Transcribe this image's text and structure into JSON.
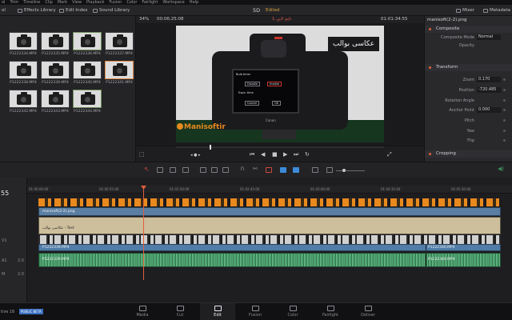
{
  "menubar": [
    "ol",
    "Trim",
    "Timeline",
    "Clip",
    "Mark",
    "View",
    "Playback",
    "Fusion",
    "Color",
    "Fairlight",
    "Workspace",
    "Help"
  ],
  "toolbar": {
    "left_label": "ol",
    "effects_library": "Effects Library",
    "edit_index": "Edit Index",
    "sound_library": "Sound Library",
    "project": "5D",
    "status": "Edited",
    "mixer": "Mixer",
    "metadata": "Metadata"
  },
  "media_pool": {
    "items": [
      {
        "name": "P1222334.MP4",
        "state": "normal"
      },
      {
        "name": "P1222335.MP4",
        "state": "normal"
      },
      {
        "name": "P1222336.MP4",
        "state": "highlight"
      },
      {
        "name": "P1222337.MP4",
        "state": "normal"
      },
      {
        "name": "P1222338.MP4",
        "state": "normal"
      },
      {
        "name": "P1222339.MP4",
        "state": "normal"
      },
      {
        "name": "P1222340.MP4",
        "state": "normal"
      },
      {
        "name": "P1222341.MP4",
        "state": "selected"
      },
      {
        "name": "P1222342.MP4",
        "state": "normal"
      },
      {
        "name": "P1222343.MP4",
        "state": "normal"
      },
      {
        "name": "P1222344.MP4",
        "state": "highlight"
      }
    ]
  },
  "viewer": {
    "zoom": "34%",
    "source_tc": "00:06:25:08",
    "clip_title": "تایم لاین 1",
    "record_tc": "01:01:34:55",
    "overlay_text": "عکاسی بوالب",
    "logo_text": "Manisoftir",
    "lcd": {
      "title": "Bulb timer",
      "disable": "Disable",
      "enable": "Enable",
      "expo": "Expo. time",
      "cancel": "Cancel",
      "ok": "OK"
    },
    "brand": "Canon"
  },
  "inspector": {
    "title": "manisoft(2-2).png",
    "composite": "Composite",
    "composite_mode_label": "Composite Mode",
    "composite_mode_value": "Normal",
    "opacity_label": "Opacity",
    "transform": "Transform",
    "zoom_label": "Zoom",
    "zoom_value": "0.170",
    "position_label": "Position",
    "position_value": "-720.485",
    "rotation_label": "Rotation Angle",
    "rotation_value": "0.000",
    "anchor_label": "Anchor Point",
    "anchor_value": "0.000",
    "pitch_label": "Pitch",
    "yaw_label": "Yaw",
    "flip_label": "Flip",
    "cropping": "Cropping"
  },
  "timeline": {
    "timecode": "55",
    "ruler": [
      "01:00:00:00",
      "01:00:55:00",
      "01:01:50:00",
      "01:02:45:00",
      "01:03:40:00",
      "01:04:35:00",
      "01:05:30:00"
    ],
    "tracks": {
      "v3_clip": "manisoft(2-2).png",
      "v2_clip": "عکاسی بوالب - Text",
      "v1_clip_a": "P1222339.MP4",
      "v1_clip_b": "P1222340.MP4",
      "a1_clip_a": "P1222339.MP4",
      "a1_clip_b": "P1222340.MP4"
    },
    "track_labels": [
      "V1",
      "A1",
      "2.0",
      "M",
      "2.0"
    ]
  },
  "pages": [
    {
      "name": "Media",
      "active": false
    },
    {
      "name": "Cut",
      "active": false
    },
    {
      "name": "Edit",
      "active": true
    },
    {
      "name": "Fusion",
      "active": false
    },
    {
      "name": "Color",
      "active": false
    },
    {
      "name": "Fairlight",
      "active": false
    },
    {
      "name": "Deliver",
      "active": false
    }
  ],
  "app_version": "tive 16",
  "beta_badge": "PUBLIC BETA"
}
